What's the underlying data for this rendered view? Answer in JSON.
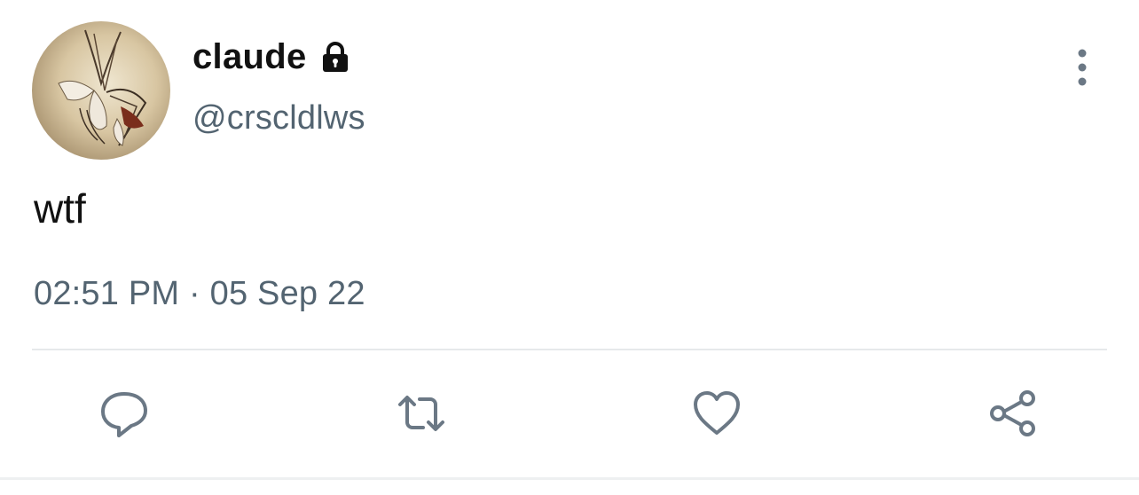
{
  "tweet": {
    "display_name": "claude",
    "handle": "@crscldlws",
    "text": "wtf",
    "timestamp": "02:51 PM · 05 Sep 22",
    "protected": true
  },
  "icons": {
    "lock": "lock-icon",
    "more": "more-vertical-icon",
    "reply": "reply-icon",
    "retweet": "retweet-icon",
    "like": "heart-icon",
    "share": "share-icon"
  },
  "colors": {
    "text": "#111111",
    "secondary": "#536471",
    "divider": "#e6e9eb"
  }
}
